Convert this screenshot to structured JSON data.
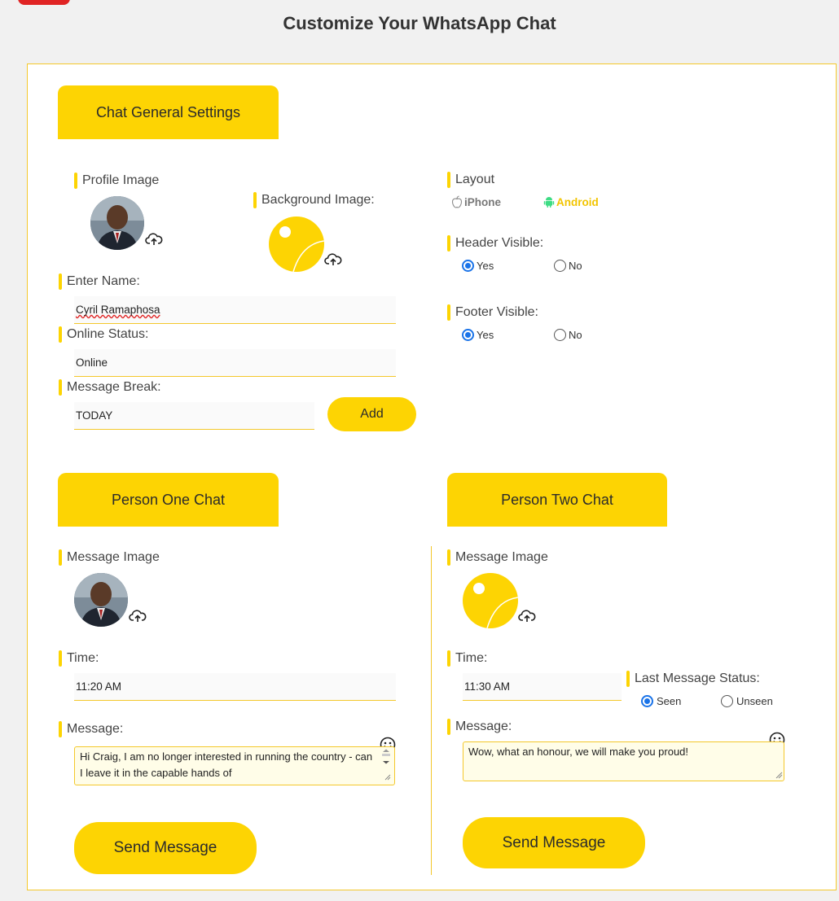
{
  "page_title": "Customize Your WhatsApp Chat",
  "general": {
    "tab_label": "Chat General Settings",
    "profile_image_label": "Profile Image",
    "background_image_label": "Background Image:",
    "name_label": "Enter Name:",
    "name_value": "Cyril Ramaphosa",
    "status_label": "Online Status:",
    "status_value": "Online",
    "break_label": "Message Break:",
    "break_value": "TODAY",
    "add_button": "Add",
    "layout_label": "Layout",
    "layout_options": [
      {
        "label": "iPhone",
        "icon": "apple-icon",
        "color": "#777777",
        "selected": false
      },
      {
        "label": "Android",
        "icon": "android-icon",
        "color": "#f2c400",
        "selected": true
      }
    ],
    "header_label": "Header Visible:",
    "header_options": [
      {
        "label": "Yes",
        "selected": true
      },
      {
        "label": "No",
        "selected": false
      }
    ],
    "footer_label": "Footer Visible:",
    "footer_options": [
      {
        "label": "Yes",
        "selected": true
      },
      {
        "label": "No",
        "selected": false
      }
    ]
  },
  "person_one": {
    "tab_label": "Person One Chat",
    "image_label": "Message Image",
    "time_label": "Time:",
    "time_value": "11:20 AM",
    "message_label": "Message:",
    "message_value": "Hi Craig, I am no longer interested in running the country - can I leave it in the capable hands of",
    "send_button": "Send Message"
  },
  "person_two": {
    "tab_label": "Person Two Chat",
    "image_label": "Message Image",
    "time_label": "Time:",
    "time_value": "11:30 AM",
    "status_label": "Last Message Status:",
    "status_options": [
      {
        "label": "Seen",
        "selected": true
      },
      {
        "label": "Unseen",
        "selected": false
      }
    ],
    "message_label": "Message:",
    "message_value": "Wow, what an honour, we will make you proud!",
    "send_button": "Send Message"
  },
  "colors": {
    "accent": "#fdd403",
    "border": "#f4c82b",
    "radio_selected": "#1a73e8",
    "android": "#f2c400"
  }
}
